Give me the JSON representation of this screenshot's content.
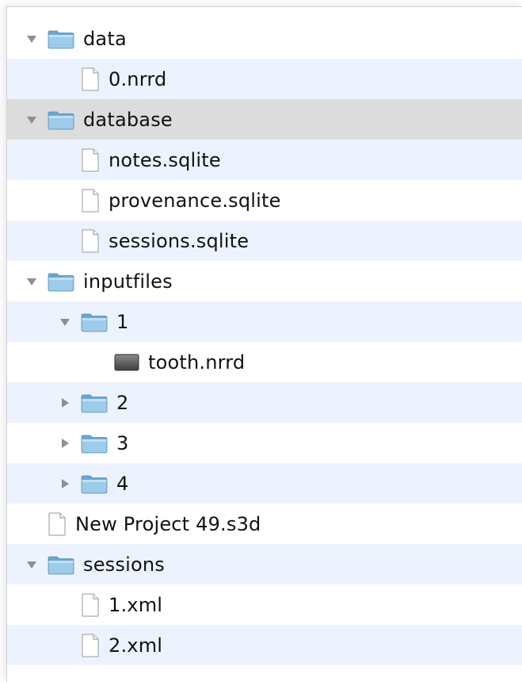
{
  "tree": {
    "rows": [
      {
        "label": "data",
        "kind": "folder",
        "level": 0,
        "disclosure": "expanded",
        "icon": "folder-icon"
      },
      {
        "label": "0.nrrd",
        "kind": "file",
        "level": 1,
        "disclosure": "none",
        "icon": "document-icon"
      },
      {
        "label": "database",
        "kind": "folder",
        "level": 0,
        "disclosure": "expanded",
        "icon": "folder-icon",
        "selected": true
      },
      {
        "label": "notes.sqlite",
        "kind": "file",
        "level": 1,
        "disclosure": "none",
        "icon": "document-icon"
      },
      {
        "label": "provenance.sqlite",
        "kind": "file",
        "level": 1,
        "disclosure": "none",
        "icon": "document-icon"
      },
      {
        "label": "sessions.sqlite",
        "kind": "file",
        "level": 1,
        "disclosure": "none",
        "icon": "document-icon"
      },
      {
        "label": "inputfiles",
        "kind": "folder",
        "level": 0,
        "disclosure": "expanded",
        "icon": "folder-icon"
      },
      {
        "label": "1",
        "kind": "folder",
        "level": 1,
        "disclosure": "expanded",
        "icon": "folder-icon"
      },
      {
        "label": "tooth.nrrd",
        "kind": "image",
        "level": 2,
        "disclosure": "none",
        "icon": "image-file-icon"
      },
      {
        "label": "2",
        "kind": "folder",
        "level": 1,
        "disclosure": "collapsed",
        "icon": "folder-icon"
      },
      {
        "label": "3",
        "kind": "folder",
        "level": 1,
        "disclosure": "collapsed",
        "icon": "folder-icon"
      },
      {
        "label": "4",
        "kind": "folder",
        "level": 1,
        "disclosure": "collapsed",
        "icon": "folder-icon"
      },
      {
        "label": "New Project 49.s3d",
        "kind": "file",
        "level": 0,
        "disclosure": "none",
        "icon": "document-icon"
      },
      {
        "label": "sessions",
        "kind": "folder",
        "level": 0,
        "disclosure": "expanded",
        "icon": "folder-icon"
      },
      {
        "label": "1.xml",
        "kind": "file",
        "level": 1,
        "disclosure": "none",
        "icon": "document-icon"
      },
      {
        "label": "2.xml",
        "kind": "file",
        "level": 1,
        "disclosure": "none",
        "icon": "document-icon"
      }
    ]
  },
  "colors": {
    "row_alt": "#edf3fe",
    "row_selected": "#dcdcdc",
    "folder": "#7fb9de",
    "disclosure": "#8f8f8f"
  }
}
